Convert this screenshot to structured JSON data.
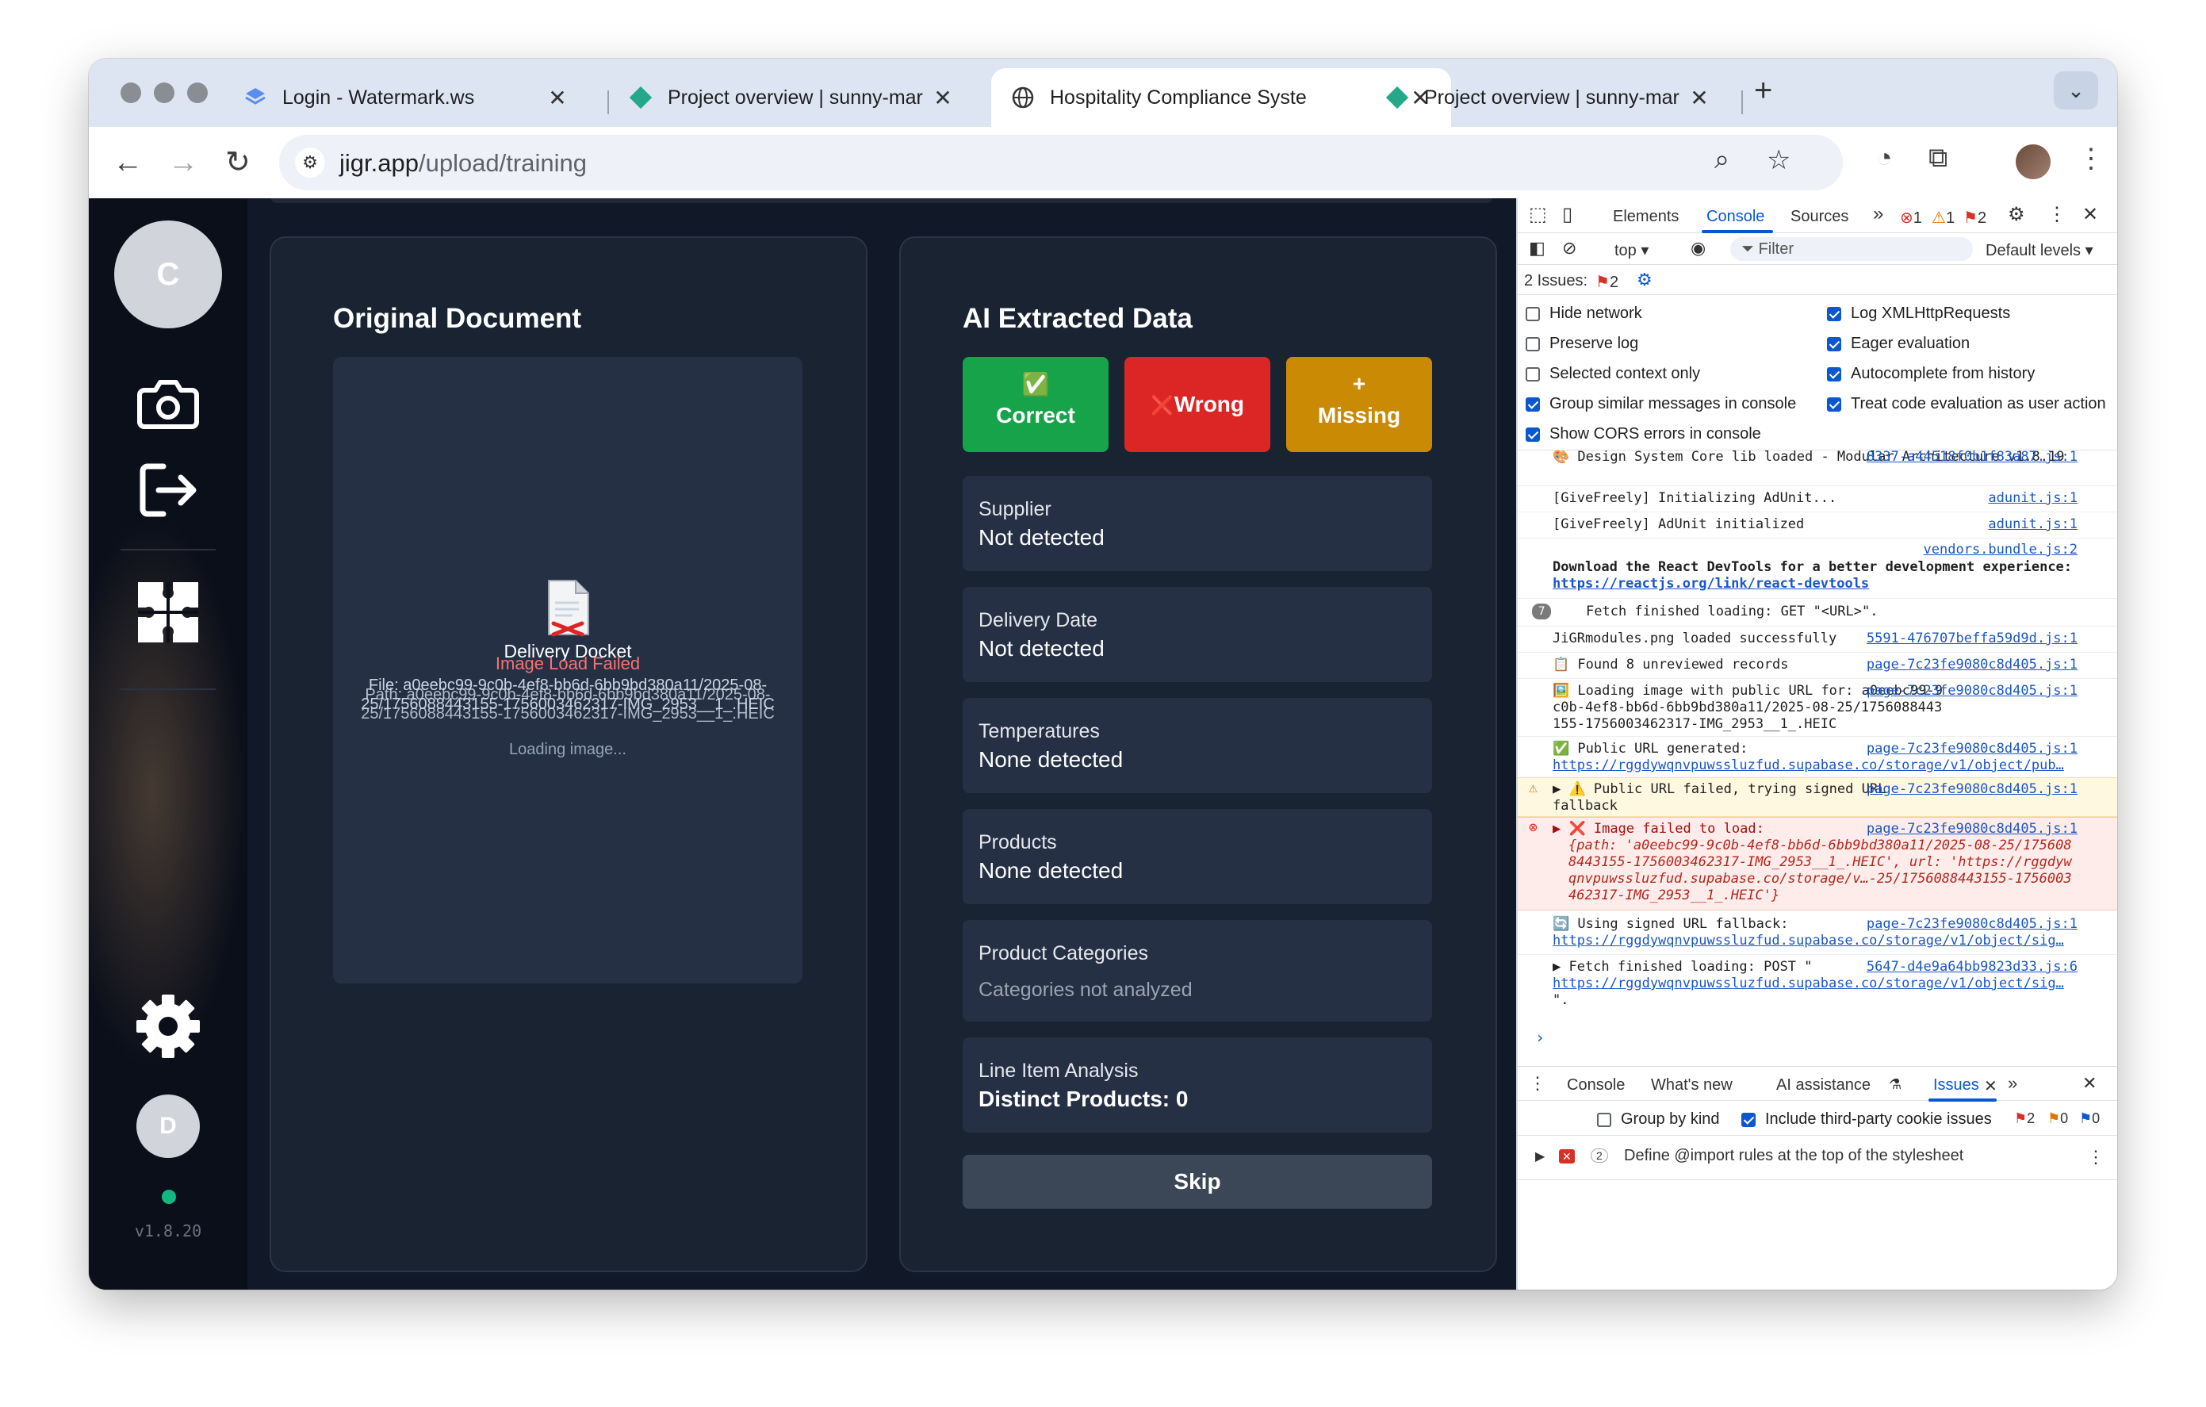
{
  "browser": {
    "tabs": [
      {
        "title": "Login - Watermark.ws",
        "icon": "watermark-logo-icon",
        "active": false
      },
      {
        "title": "Project overview | sunny-mar",
        "icon": "supabase-logo-icon",
        "active": false
      },
      {
        "title": "Hospitality Compliance Syste",
        "icon": "globe-icon",
        "active": true
      },
      {
        "title": "Project overview | sunny-mar",
        "icon": "supabase-logo-icon",
        "active": false
      }
    ],
    "close_glyph": "✕",
    "new_tab_glyph": "+",
    "tab_menu_glyph": "⌄",
    "url_host": "jigr.app",
    "url_path": "/upload/training"
  },
  "app": {
    "sidebar": {
      "avatar_initial": "C",
      "user_initial": "D",
      "version": "v1.8.20"
    },
    "left_panel": {
      "title": "Original Document",
      "overlay_title": "Delivery Docket",
      "overlay_error": "Image Load Failed",
      "file_line": "File: a0eebc99-9c0b-4ef8-bb6d-6bb9bd380a11/2025-08-25/1756088443155-1756003462317-IMG_2953__1_.HEIC",
      "path_line": "Path: a0eebc99-9c0b-4ef8-bb6d-6bb9bd380a11/2025-08-25/1756088443155-1756003462317-IMG_2953__1_.HEIC",
      "loading": "Loading image..."
    },
    "right_panel": {
      "title": "AI Extracted Data",
      "buttons": [
        {
          "symbol": "✅",
          "label": "Correct",
          "color": "#16a34a"
        },
        {
          "symbol": "❌",
          "label": "Wrong",
          "color": "#dc2626"
        },
        {
          "symbol": "+",
          "label": "Missing",
          "color": "#ca8a04"
        }
      ],
      "fields": [
        {
          "label": "Supplier",
          "value": "Not detected"
        },
        {
          "label": "Delivery Date",
          "value": "Not detected"
        },
        {
          "label": "Temperatures",
          "value": "None detected"
        },
        {
          "label": "Products",
          "value": "None detected"
        },
        {
          "label": "Product Categories",
          "value": "Categories not analyzed"
        },
        {
          "label": "Line Item Analysis",
          "value": "Distinct Products: 0"
        }
      ],
      "skip_label": "Skip"
    }
  },
  "devtools": {
    "tabs": [
      "Elements",
      "Console",
      "Sources"
    ],
    "active_tab": "Console",
    "more_glyph": "»",
    "counts": {
      "errors": "1",
      "warnings": "1",
      "issues": "2"
    },
    "context": "top ▾",
    "filter_placeholder": "Filter",
    "levels": "Default levels ▾",
    "issues_label": "2 Issues:",
    "issues_count": "2",
    "options_left": [
      "Hide network",
      "Preserve log",
      "Selected context only",
      "Group similar messages in console",
      "Show CORS errors in console"
    ],
    "options_left_checked": [
      false,
      false,
      false,
      true,
      true
    ],
    "options_right": [
      "Log XMLHttpRequests",
      "Eager evaluation",
      "Autocomplete from history",
      "Treat code evaluation as user action"
    ],
    "options_right_checked": [
      true,
      true,
      true,
      true
    ],
    "console": {
      "m0_text": "🎨 Design System Core lib loaded - Modular Architecture v1.8.19",
      "m0_src": "8337-a44518f0b1f83a87.js:1",
      "m1_text": "[GiveFreely] Initializing AdUnit...",
      "m1_src": "adunit.js:1",
      "m2_text": "[GiveFreely] AdUnit initialized",
      "m2_src": "adunit.js:1",
      "m3_src": "vendors.bundle.js:2",
      "m3_text": "Download the React DevTools for a better development experience: ",
      "m3_link": "https://reactjs.org/link/react-devtools",
      "m4_count": "7",
      "m4_text": "Fetch finished loading: GET \"<URL>\".",
      "m5_text": "JiGRmodules.png loaded successfully",
      "m5_src": "5591-476707beffa59d9d.js:1",
      "m6_text": "📋 Found 8 unreviewed records",
      "m6_src": "page-7c23fe9080c8d405.js:1",
      "m7_text": "🖼️ Loading image with public URL for: a0eebc99-9c0b-4ef8-bb6d-6bb9bd380a11/2025-08-25/1756088443155-1756003462317-IMG_2953__1_.HEIC",
      "m7_src": "page-7c23fe9080c8d405.js:1",
      "m8_text": "✅ Public URL generated:",
      "m8_link": "https://rggdywqnvpuwssluzfud.supabase.co/storage/v1/object/pub…",
      "m8_src": "page-7c23fe9080c8d405.js:1",
      "m9_text": "▶ ⚠️ Public URL failed, trying signed URL fallback",
      "m9_src": "page-7c23fe9080c8d405.js:1",
      "m10_text": "▶ ❌ Image failed to load:",
      "m10_src": "page-7c23fe9080c8d405.js:1",
      "m10_detail": "{path: 'a0eebc99-9c0b-4ef8-bb6d-6bb9bd380a11/2025-08-25/1756088443155-1756003462317-IMG_2953__1_.HEIC', url: 'https://rggdywqnvpuwssluzfud.supabase.co/storage/v…-25/1756088443155-1756003462317-IMG_2953__1_.HEIC'}",
      "m11_text": "🔄 Using signed URL fallback:",
      "m11_link": "https://rggdywqnvpuwssluzfud.supabase.co/storage/v1/object/sig…",
      "m11_src": "page-7c23fe9080c8d405.js:1",
      "m12_text": "▶ Fetch finished loading: POST \"",
      "m12_link": "https://rggdywqnvpuwssluzfud.supabase.co/storage/v1/object/sig…",
      "m12_tail": "\".",
      "m12_src": "5647-d4e9a64bb9823d33.js:6",
      "prompt": "›"
    },
    "drawer_tabs": [
      "Console",
      "What's new",
      "AI assistance",
      "Issues"
    ],
    "drawer_active": "Issues",
    "group_by_kind": "Group by kind",
    "include_third_party": "Include third-party cookie issues",
    "drawer_counts": {
      "errors": "2",
      "warnings": "0",
      "info": "0"
    },
    "issue": {
      "count": "2",
      "text": "Define @import rules at the top of the stylesheet"
    }
  }
}
